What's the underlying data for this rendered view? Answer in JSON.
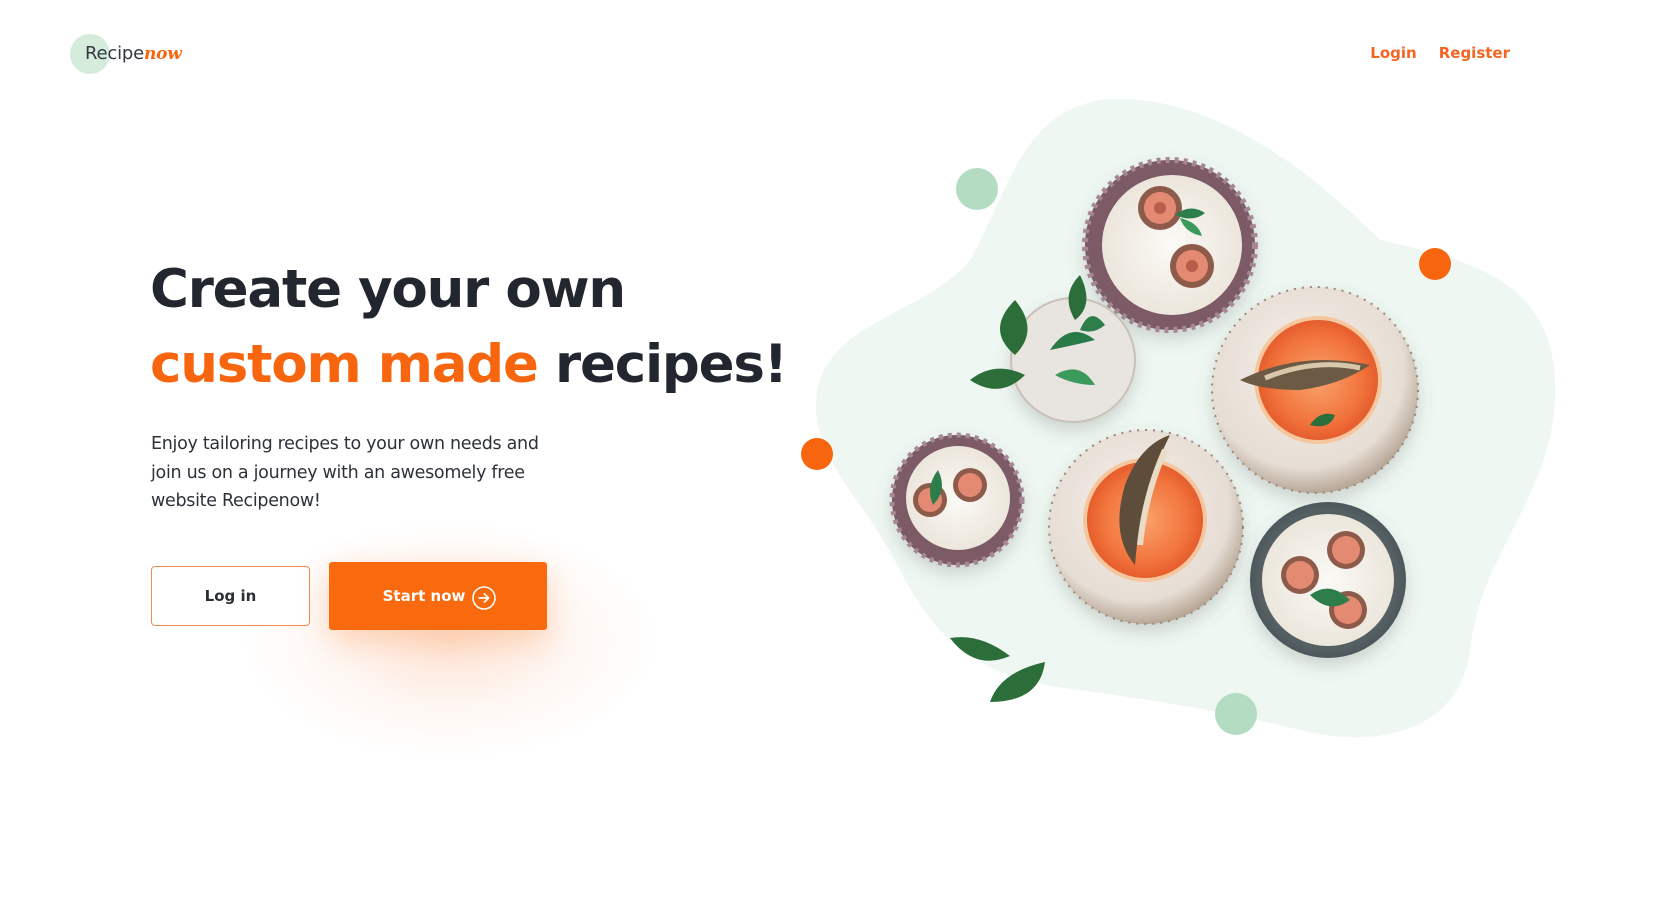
{
  "brand": {
    "name": "Recipe",
    "name_accent": "now",
    "accent_color": "#f7660f",
    "circle_color": "#d5ecdd"
  },
  "nav": {
    "login": "Login",
    "register": "Register"
  },
  "hero": {
    "title_line1": "Create your own",
    "title_accent": "custom made",
    "title_rest": " recipes!",
    "description": "Enjoy tailoring recipes to your own needs and join us on a journey with an awesomely free website Recipenow!"
  },
  "buttons": {
    "login": "Log in",
    "start": "Start now"
  },
  "illustration": {
    "blob_color": "#eef7f1",
    "dot_green": "#b4dcc3",
    "dot_orange": "#f7660f",
    "icons": [
      "fig-yogurt-bowl-icon",
      "grapefruit-fish-plate-icon",
      "herb-plate-icon",
      "leaf-icon"
    ]
  }
}
